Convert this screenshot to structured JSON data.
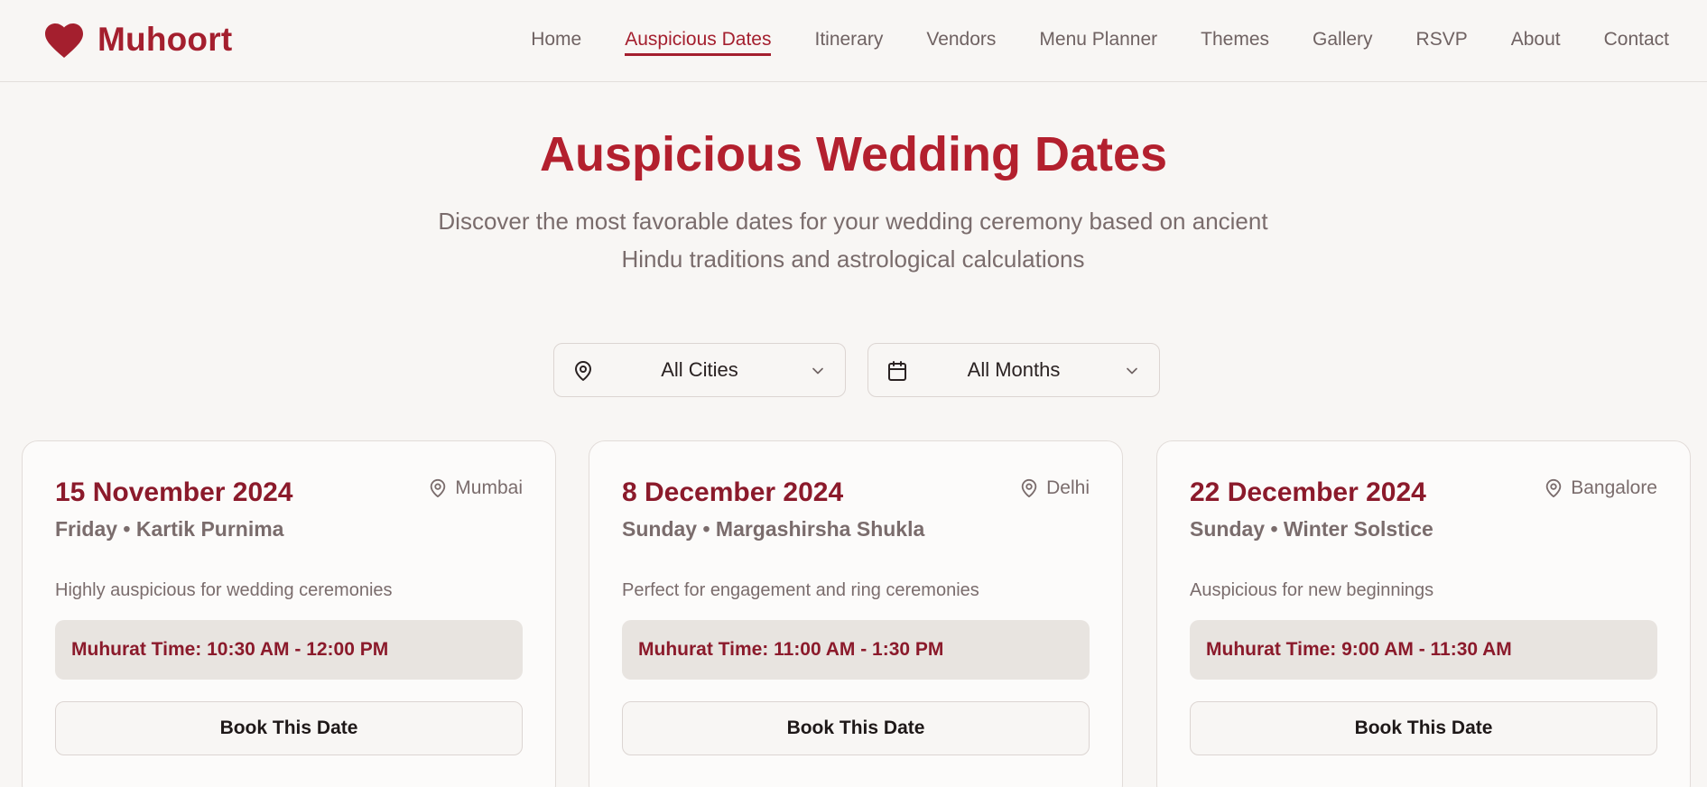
{
  "brand": {
    "name": "Muhoort",
    "logo_icon": "heart-icon",
    "accent_color": "#a41f2e"
  },
  "nav": {
    "items": [
      {
        "label": "Home",
        "active": false
      },
      {
        "label": "Auspicious Dates",
        "active": true
      },
      {
        "label": "Itinerary",
        "active": false
      },
      {
        "label": "Vendors",
        "active": false
      },
      {
        "label": "Menu Planner",
        "active": false
      },
      {
        "label": "Themes",
        "active": false
      },
      {
        "label": "Gallery",
        "active": false
      },
      {
        "label": "RSVP",
        "active": false
      },
      {
        "label": "About",
        "active": false
      },
      {
        "label": "Contact",
        "active": false
      }
    ]
  },
  "hero": {
    "title": "Auspicious Wedding Dates",
    "subtitle_line1": "Discover the most favorable dates for your wedding ceremony based on ancient",
    "subtitle_line2": "Hindu traditions and astrological calculations"
  },
  "filters": {
    "city": {
      "selected": "All Cities",
      "icon": "map-pin-icon"
    },
    "month": {
      "selected": "All Months",
      "icon": "calendar-icon"
    }
  },
  "cards": [
    {
      "date": "15 November 2024",
      "location": "Mumbai",
      "day_info": "Friday • Kartik Purnima",
      "description": "Highly auspicious for wedding ceremonies",
      "muhurat": "Muhurat Time: 10:30 AM - 12:00 PM",
      "button": "Book This Date"
    },
    {
      "date": "8 December 2024",
      "location": "Delhi",
      "day_info": "Sunday • Margashirsha Shukla",
      "description": "Perfect for engagement and ring ceremonies",
      "muhurat": "Muhurat Time: 11:00 AM - 1:30 PM",
      "button": "Book This Date"
    },
    {
      "date": "22 December 2024",
      "location": "Bangalore",
      "day_info": "Sunday • Winter Solstice",
      "description": "Auspicious for new beginnings",
      "muhurat": "Muhurat Time: 9:00 AM - 11:30 AM",
      "button": "Book This Date"
    }
  ]
}
